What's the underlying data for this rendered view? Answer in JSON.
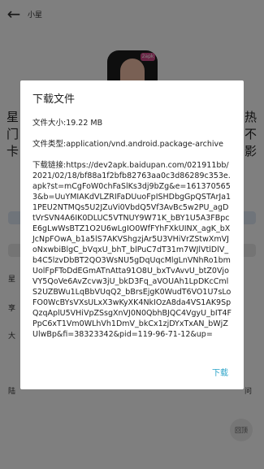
{
  "topbar": {
    "back_glyph": "←",
    "title": "小星"
  },
  "app_icon": {
    "badge": "2apk"
  },
  "background_text": {
    "left_1": "星",
    "left_2": "门",
    "left_3": "卡",
    "right_1": "热",
    "right_2": "不",
    "right_3": "影",
    "para_1": "星",
    "para_2": "享",
    "para_3": "大",
    "para_4": "陆",
    "para_5": "问"
  },
  "fab": {
    "label": "回顶"
  },
  "dialog": {
    "title": "下载文件",
    "size_label": "文件大小:",
    "size_value": "19.22 MB",
    "type_label": "文件类型:",
    "type_value": "application/vnd.android.package-archive",
    "link_label": "下载链接:",
    "link_value": "https://dev2apk.baidupan.com/021911bb/2021/02/18/bf88a1f2bfb82763aa0c3d86289c353e.apk?st=mCgFoW0chFaSlKs3dj9bZg&e=1613705653&b=UuYMIAKdVLZRIFaDUuoFpISHDbgGpQSTArJa11PEU2NTMQs5U2JZuVi0VbdQ5Vf3AvBc5w2PU_agDtVrSVN4A6IK0DLUC5VTNUY9W71K_bBY1U5A3FBpcE6gLwWsBTZ1O2U6wLgIO0WfFYhFXkUINX_agK_bXJcNpFOwA_b1a5lS7AKVShgzjAr5U3VHiVrZStwXmVJoNxwbiBlgC_bVqxU_bhT_blPuC7dT31m7WJlVtlDlV_b4C5lzvDbBT2QO3WsNU5gDqUqcMlgLnVNhRo1bmUolFpFToDdEGmATnAtta91O8U_bxTvAvvU_btZ0VjoVY5QoVe6AvZcvw3jU_bkD3Fq_aVOUAh1LpDKcCmlS2UZBWu1LqBbVUqQ2_bBrsEjgK0WudT6VO1U7sLoFO0WcBYsVXsULxX3wKyXK4NkIOzA8da4VS1AK9SpQzqAplU5VHiVpZSsgXnVJ0N0QbhBJQC4VgyU_bIT4FPpC6xT1Vm0WLhVh1DmV_bkCx1zjDYxTxAN_bWjZUlwBp&fi=38323342&pid=119-96-71-12&up=",
    "download_label": "下载"
  }
}
